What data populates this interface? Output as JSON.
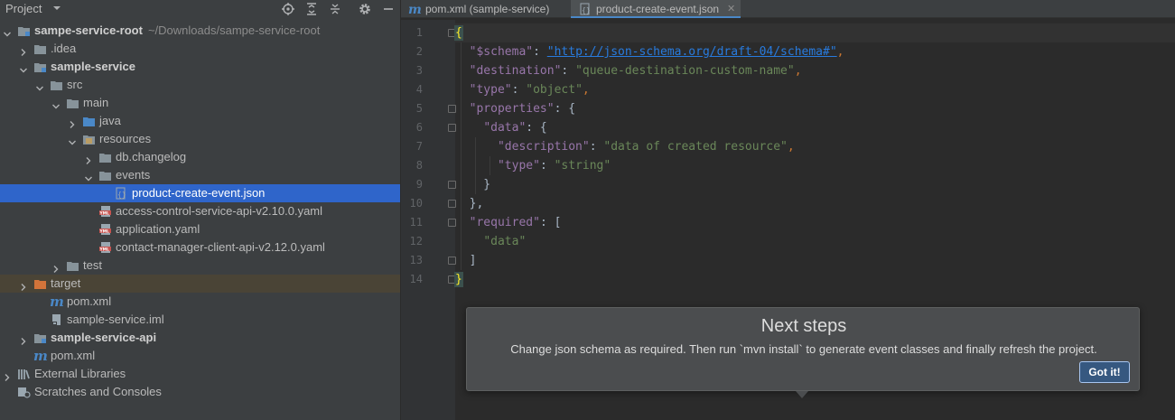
{
  "project_panel": {
    "title": "Project",
    "header_icons": [
      "locate-icon",
      "expand-all-icon",
      "collapse-all-icon",
      "settings-icon",
      "hide-icon"
    ]
  },
  "tree": [
    {
      "label": "sampe-service-root",
      "path": "~/Downloads/sampe-service-root",
      "icon": "module-folder-icon",
      "expanded": true,
      "bold": true
    },
    {
      "label": ".idea",
      "icon": "folder-icon",
      "expanded": false
    },
    {
      "label": "sample-service",
      "icon": "module-folder-icon",
      "expanded": true,
      "bold": true
    },
    {
      "label": "src",
      "icon": "folder-icon",
      "expanded": true
    },
    {
      "label": "main",
      "icon": "folder-icon",
      "expanded": true
    },
    {
      "label": "java",
      "icon": "source-folder-icon",
      "expanded": false
    },
    {
      "label": "resources",
      "icon": "resources-folder-icon",
      "expanded": true
    },
    {
      "label": "db.changelog",
      "icon": "folder-icon",
      "expanded": false
    },
    {
      "label": "events",
      "icon": "folder-icon",
      "expanded": true
    },
    {
      "label": "product-create-event.json",
      "icon": "json-file-icon",
      "selected": true
    },
    {
      "label": "access-control-service-api-v2.10.0.yaml",
      "icon": "yaml-file-icon"
    },
    {
      "label": "application.yaml",
      "icon": "yaml-file-icon"
    },
    {
      "label": "contact-manager-client-api-v2.12.0.yaml",
      "icon": "yaml-file-icon"
    },
    {
      "label": "test",
      "icon": "folder-icon",
      "expanded": false
    },
    {
      "label": "target",
      "icon": "excluded-folder-icon",
      "expanded": false,
      "excluded": true
    },
    {
      "label": "pom.xml",
      "icon": "maven-file-icon"
    },
    {
      "label": "sample-service.iml",
      "icon": "iml-file-icon"
    },
    {
      "label": "sample-service-api",
      "icon": "module-folder-icon",
      "expanded": false,
      "bold": true
    },
    {
      "label": "pom.xml",
      "icon": "maven-file-icon"
    },
    {
      "label": "External Libraries",
      "icon": "libraries-icon",
      "expanded": false
    },
    {
      "label": "Scratches and Consoles",
      "icon": "scratches-icon"
    }
  ],
  "tabs": [
    {
      "label": "pom.xml (sample-service)",
      "icon": "maven-file-icon",
      "active": false
    },
    {
      "label": "product-create-event.json",
      "icon": "json-file-icon",
      "active": true,
      "close": "✕"
    }
  ],
  "editor": {
    "line_numbers": [
      "1",
      "2",
      "3",
      "4",
      "5",
      "6",
      "7",
      "8",
      "9",
      "10",
      "11",
      "12",
      "13",
      "14"
    ],
    "lines": [
      [
        "{"
      ],
      [
        "  ",
        "\"$schema\"",
        ": ",
        "\"http://json-schema.org/draft-04/schema#\"",
        ","
      ],
      [
        "  ",
        "\"destination\"",
        ": ",
        "\"queue-destination-custom-name\"",
        ","
      ],
      [
        "  ",
        "\"type\"",
        ": ",
        "\"object\"",
        ","
      ],
      [
        "  ",
        "\"properties\"",
        ": {"
      ],
      [
        "    ",
        "\"data\"",
        ": {"
      ],
      [
        "      ",
        "\"description\"",
        ": ",
        "\"data of created resource\"",
        ","
      ],
      [
        "      ",
        "\"type\"",
        ": ",
        "\"string\""
      ],
      [
        "    }"
      ],
      [
        "  },"
      ],
      [
        "  ",
        "\"required\"",
        ": ["
      ],
      [
        "    ",
        "\"data\""
      ],
      [
        "  ]"
      ],
      [
        "}"
      ]
    ]
  },
  "popup": {
    "title": "Next steps",
    "message": "Change json schema as required. Then run `mvn install` to generate event classes and finally refresh the project.",
    "button": "Got it!"
  }
}
